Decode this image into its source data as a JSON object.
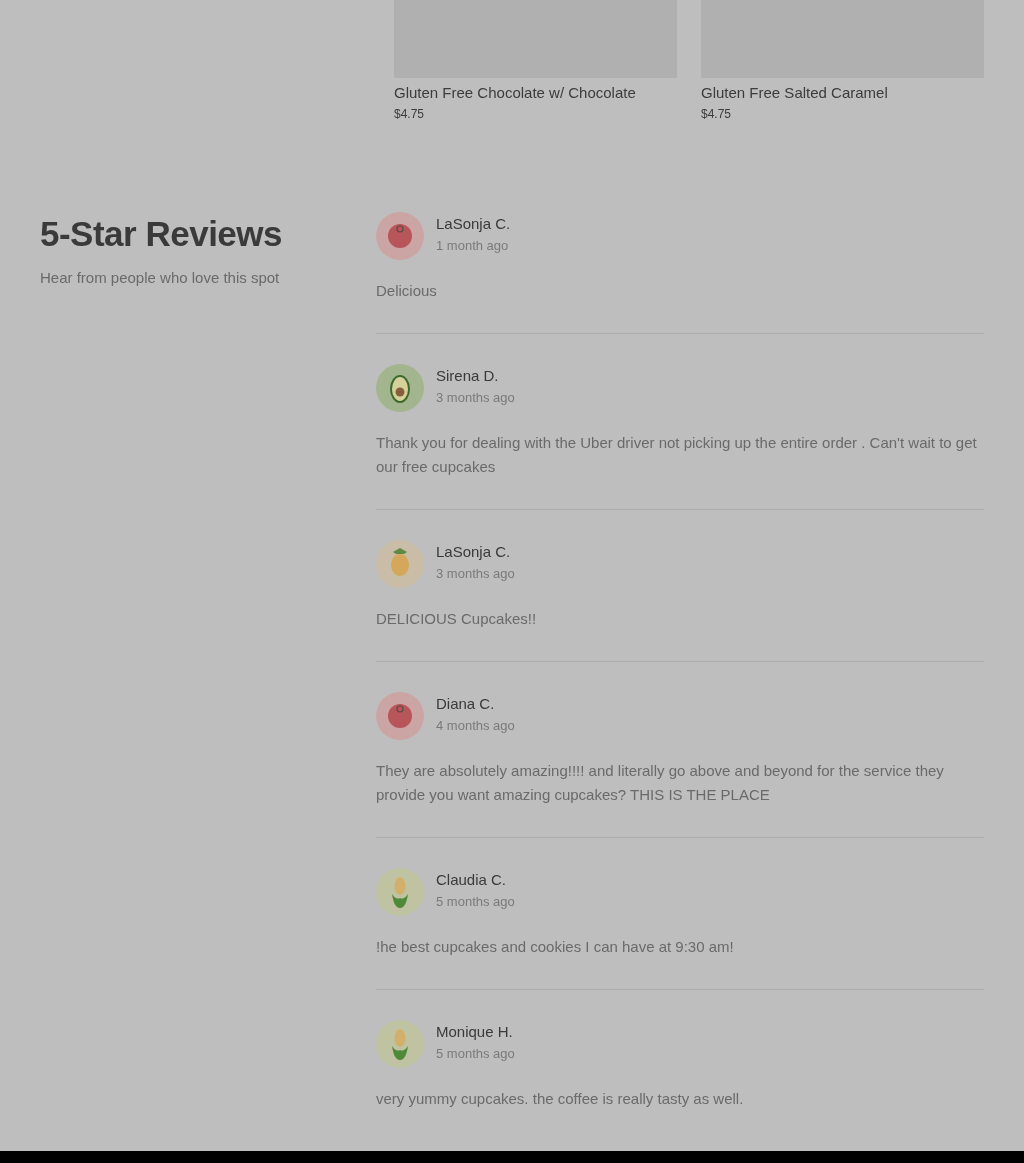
{
  "products": [
    {
      "name": "Gluten Free Chocolate w/ Chocolate",
      "price": "$4.75",
      "image": {
        "kind": "placeholder"
      }
    },
    {
      "name": "Gluten Free Salted Caramel",
      "price": "$4.75",
      "image": {
        "kind": "placeholder"
      }
    }
  ],
  "reviews_section": {
    "title": "5-Star Reviews",
    "subtitle": "Hear from people who love this spot"
  },
  "reviews": [
    {
      "author": "LaSonja C.",
      "time": "1 month ago",
      "text": "Delicious",
      "avatar": {
        "kind": "tomato"
      }
    },
    {
      "author": "Sirena D.",
      "time": "3 months ago",
      "text": "Thank you for dealing with the Uber driver not picking up the entire order . Can't wait to get our free cupcakes",
      "avatar": {
        "kind": "avocado"
      }
    },
    {
      "author": "LaSonja C.",
      "time": "3 months ago",
      "text": "DELICIOUS Cupcakes!!",
      "avatar": {
        "kind": "pineapple"
      }
    },
    {
      "author": "Diana C.",
      "time": "4 months ago",
      "text": "They are absolutely amazing!!!! and literally go above and beyond for the service they provide you want amazing cupcakes? THIS IS THE PLACE",
      "avatar": {
        "kind": "tomato"
      }
    },
    {
      "author": "Claudia C.",
      "time": "5 months ago",
      "text": "!he best cupcakes and cookies I can have at 9:30 am!",
      "avatar": {
        "kind": "corn"
      }
    },
    {
      "author": "Monique H.",
      "time": "5 months ago",
      "text": "very yummy cupcakes. the coffee is really tasty as well.",
      "avatar": {
        "kind": "corn"
      }
    }
  ]
}
